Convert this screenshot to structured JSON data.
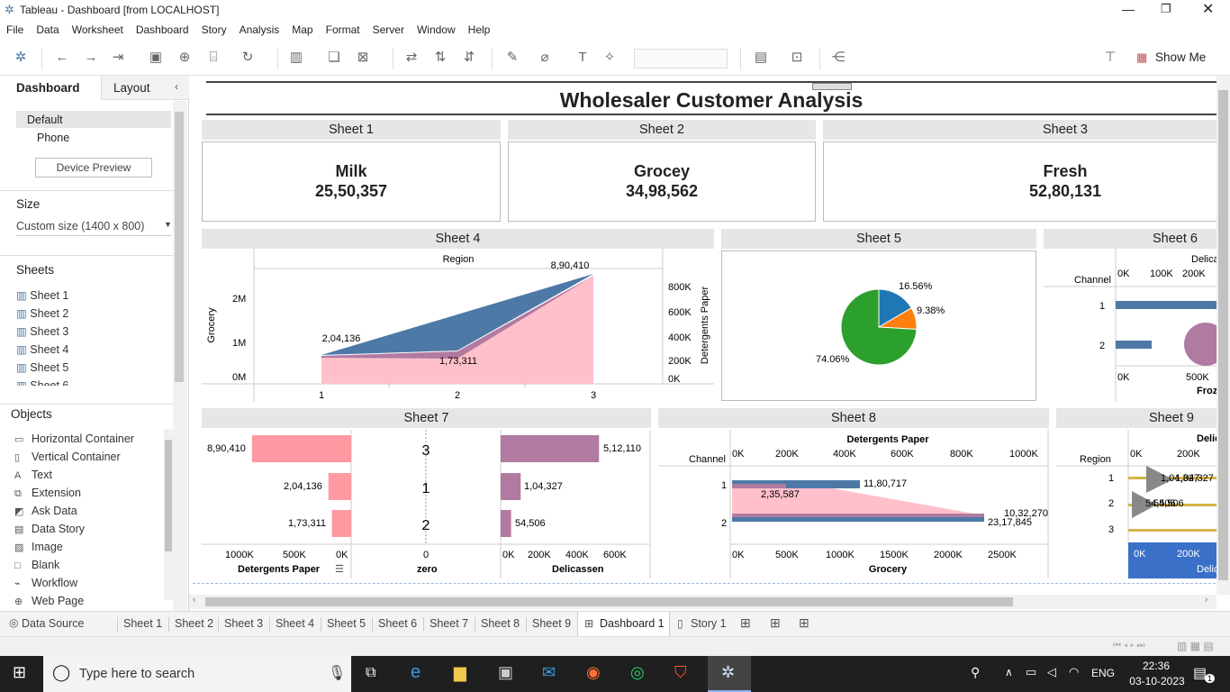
{
  "window": {
    "title": "Tableau - Dashboard [from LOCALHOST]"
  },
  "menu": [
    "File",
    "Data",
    "Worksheet",
    "Dashboard",
    "Story",
    "Analysis",
    "Map",
    "Format",
    "Server",
    "Window",
    "Help"
  ],
  "toolbar": {
    "show_me": "Show Me"
  },
  "left": {
    "tab_dashboard": "Dashboard",
    "tab_layout": "Layout",
    "devices": [
      "Default",
      "Phone"
    ],
    "device_preview": "Device Preview",
    "size_label": "Size",
    "size_value": "Custom size (1400 x 800)",
    "sheets_label": "Sheets",
    "sheets": [
      "Sheet 1",
      "Sheet 2",
      "Sheet 3",
      "Sheet 4",
      "Sheet 5",
      "Sheet 6"
    ],
    "objects_label": "Objects",
    "objects": [
      {
        "label": "Horizontal Container",
        "icon": "horizontal-container-icon"
      },
      {
        "label": "Vertical Container",
        "icon": "vertical-container-icon"
      },
      {
        "label": "Text",
        "icon": "text-icon"
      },
      {
        "label": "Extension",
        "icon": "extension-icon"
      },
      {
        "label": "Ask Data",
        "icon": "ask-data-icon"
      },
      {
        "label": "Data Story",
        "icon": "data-story-icon"
      },
      {
        "label": "Image",
        "icon": "image-icon"
      },
      {
        "label": "Blank",
        "icon": "blank-icon"
      },
      {
        "label": "Workflow",
        "icon": "workflow-icon"
      },
      {
        "label": "Web Page",
        "icon": "web-page-icon"
      }
    ]
  },
  "dashboard": {
    "title": "Wholesaler Customer Analysis",
    "sheet_titles": [
      "Sheet 1",
      "Sheet 2",
      "Sheet 3",
      "Sheet 4",
      "Sheet 5",
      "Sheet 6",
      "Sheet 7",
      "Sheet 8",
      "Sheet 9"
    ],
    "kpis": [
      {
        "label": "Milk",
        "value": "25,50,357"
      },
      {
        "label": "Grocey",
        "value": "34,98,562"
      },
      {
        "label": "Fresh",
        "value": "52,80,131"
      }
    ],
    "sheet4": {
      "header": "Region",
      "y_left": "Grocery",
      "y_right": "Detergents Paper",
      "left_ticks": [
        "2M",
        "1M",
        "0M"
      ],
      "right_ticks": [
        "800K",
        "600K",
        "400K",
        "200K",
        "0K"
      ],
      "x_ticks": [
        "1",
        "2",
        "3"
      ],
      "labels": [
        "8,90,410",
        "2,04,136",
        "1,73,311"
      ]
    },
    "sheet5": {
      "labels": [
        "16.56%",
        "9.38%",
        "74.06%"
      ]
    },
    "sheet6": {
      "header": "Delica",
      "row_header": "Channel",
      "top_ticks": [
        "0K",
        "100K",
        "200K"
      ],
      "rows": [
        "1",
        "2"
      ],
      "bottom_ticks": [
        "0K",
        "500K"
      ],
      "bottom_label": "Froz"
    },
    "sheet7": {
      "rows": [
        "3",
        "1",
        "2"
      ],
      "left_values": [
        "8,90,410",
        "2,04,136",
        "1,73,311"
      ],
      "right_values": [
        "5,12,110",
        "1,04,327",
        "54,506"
      ],
      "left_ticks": [
        "1000K",
        "500K",
        "0K"
      ],
      "mid_tick": "0",
      "right_ticks": [
        "0K",
        "200K",
        "400K",
        "600K"
      ],
      "left_axis": "Detergents Paper",
      "mid_axis": "zero",
      "right_axis": "Delicassen"
    },
    "sheet8": {
      "top_axis": "Detergents Paper",
      "row_header": "Channel",
      "top_ticks": [
        "0K",
        "200K",
        "400K",
        "600K",
        "800K",
        "1000K"
      ],
      "bottom_ticks": [
        "0K",
        "500K",
        "1000K",
        "1500K",
        "2000K",
        "2500K"
      ],
      "bottom_axis": "Grocery",
      "rows": [
        "1",
        "2"
      ],
      "labels": [
        "11,80,717",
        "2,35,587",
        "10,32,270",
        "23,17,845"
      ]
    },
    "sheet9": {
      "header": "Delic",
      "row_header": "Region",
      "top_ticks": [
        "0K",
        "200K"
      ],
      "rows": [
        "1",
        "2",
        "3"
      ],
      "labels": [
        "1,04,327",
        "1,04,327",
        "54,506",
        "54,506"
      ],
      "bottom_ticks": [
        "0K",
        "200K"
      ],
      "bottom_label": "Delic"
    }
  },
  "tabs": {
    "data_source": "Data Source",
    "sheets": [
      "Sheet 1",
      "Sheet 2",
      "Sheet 3",
      "Sheet 4",
      "Sheet 5",
      "Sheet 6",
      "Sheet 7",
      "Sheet 8",
      "Sheet 9"
    ],
    "dashboard": "Dashboard 1",
    "story": "Story 1"
  },
  "taskbar": {
    "search_placeholder": "Type here to search",
    "lang": "ENG",
    "time": "22:36",
    "date": "03-10-2023",
    "notif_count": "1"
  },
  "colors": {
    "blue": "#4e79a7",
    "pink": "#ffc0cb",
    "purple": "#b07aa1",
    "green": "#2ca02c",
    "orange": "#ff7f0e",
    "pieblue": "#1f77b4",
    "gold": "#d4b44a",
    "slate": "#3a70c7"
  }
}
